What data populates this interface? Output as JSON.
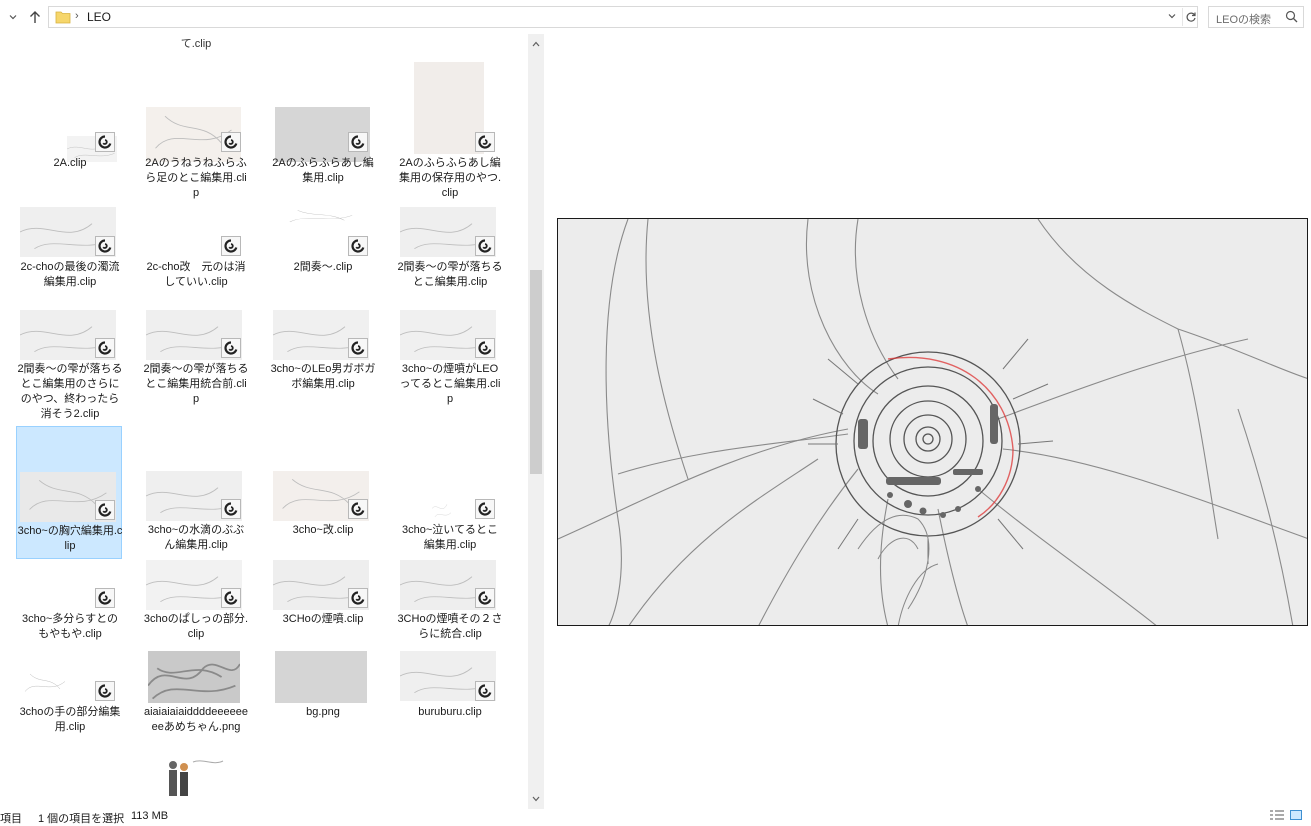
{
  "address_bar": {
    "path": "LEO",
    "search_placeholder": "LEOの検索"
  },
  "grid": {
    "partial_top_label": "て.clip",
    "items": [
      {
        "label": "2A.clip"
      },
      {
        "label": "2Aのうねうねふらふら足のとこ編集用.clip"
      },
      {
        "label": "2Aのふらふらあし編集用.clip"
      },
      {
        "label": "2Aのふらふらあし編集用の保存用のやつ.clip"
      },
      {
        "label": "2c-choの最後の濁流編集用.clip"
      },
      {
        "label": "2c-cho改　元のは消していい.clip"
      },
      {
        "label": "2間奏～.clip"
      },
      {
        "label": "2間奏～の雫が落ちるとこ編集用.clip"
      },
      {
        "label": "2間奏～の雫が落ちるとこ編集用のさらにのやつ、終わったら消そう2.clip"
      },
      {
        "label": "2間奏～の雫が落ちるとこ編集用統合前.clip"
      },
      {
        "label": "3cho~のLEo男ガボガボ編集用.clip"
      },
      {
        "label": "3cho~の煙噴がLEOってるとこ編集用.clip"
      },
      {
        "label": "3cho~の胸穴編集用.clip"
      },
      {
        "label": "3cho~の水滴のぶぶん編集用.clip"
      },
      {
        "label": "3cho~改.clip"
      },
      {
        "label": "3cho~泣いてるとこ編集用.clip"
      },
      {
        "label": "3cho~多分らすとのもやもや.clip"
      },
      {
        "label": "3choのぱしっの部分.clip"
      },
      {
        "label": "3CHoの煙噴.clip"
      },
      {
        "label": "3CHoの煙噴その２さらに統合.clip"
      },
      {
        "label": "3choの手の部分編集用.clip"
      },
      {
        "label": "aiaiaiaiaiddddeeeeeeeeあめちゃん.png"
      },
      {
        "label": "bg.png"
      },
      {
        "label": "buruburu.clip"
      }
    ]
  },
  "status_bar": {
    "count_text": "項目",
    "selection_text": "1 個の項目を選択",
    "size_text": "113 MB"
  }
}
